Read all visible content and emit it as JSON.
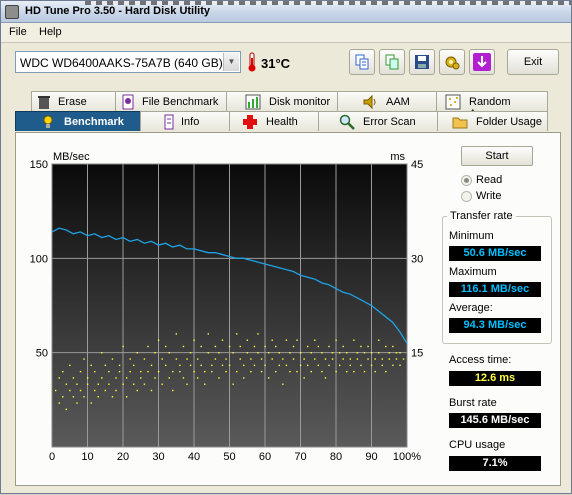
{
  "window": {
    "title": "HD Tune Pro 3.50 - Hard Disk Utility"
  },
  "menu": {
    "file": "File",
    "help": "Help"
  },
  "toolbar": {
    "drive": "WDC WD6400AAKS-75A7B (640 GB)",
    "temperature": "31°C",
    "exit_label": "Exit",
    "icons": [
      "copy-text-icon",
      "copy-screenshot-icon",
      "save-icon",
      "options-icon",
      "download-icon"
    ]
  },
  "tabs": {
    "row1": [
      "Erase",
      "File Benchmark",
      "Disk monitor",
      "AAM",
      "Random Access"
    ],
    "row2": [
      "Benchmark",
      "Info",
      "Health",
      "Error Scan",
      "Folder Usage"
    ],
    "active": "Benchmark"
  },
  "controls": {
    "start": "Start",
    "read": "Read",
    "write": "Write",
    "selected_mode": "Read"
  },
  "stats": {
    "transfer_rate_title": "Transfer rate",
    "minimum_label": "Minimum",
    "minimum": "50.6 MB/sec",
    "maximum_label": "Maximum",
    "maximum": "116.1 MB/sec",
    "average_label": "Average:",
    "average": "94.3 MB/sec",
    "access_label": "Access time:",
    "access": "12.6 ms",
    "burst_label": "Burst rate",
    "burst": "145.6 MB/sec",
    "cpu_label": "CPU usage",
    "cpu": "7.1%",
    "colors": {
      "transfer": "#00bfff",
      "access": "#ffff40",
      "plain": "#ffffff"
    }
  },
  "chart_data": {
    "type": "line",
    "y_left_label": "MB/sec",
    "y_right_label": "ms",
    "y_left_ticks": [
      "150",
      "100",
      "50"
    ],
    "y_right_ticks": [
      "45",
      "30",
      "15"
    ],
    "x_ticks": [
      "0",
      "10",
      "20",
      "30",
      "40",
      "50",
      "60",
      "70",
      "80",
      "90",
      "100%"
    ],
    "ylim_left": [
      0,
      150
    ],
    "ylim_right": [
      0,
      45
    ],
    "xlim": [
      0,
      100
    ],
    "series": [
      {
        "kind": "transfer_rate",
        "color": "#1fa3e6",
        "x": [
          0,
          2,
          4,
          6,
          8,
          10,
          12,
          14,
          16,
          18,
          20,
          22,
          24,
          26,
          28,
          30,
          32,
          34,
          36,
          38,
          40,
          42,
          44,
          46,
          48,
          50,
          52,
          54,
          56,
          58,
          60,
          62,
          64,
          66,
          68,
          70,
          72,
          74,
          76,
          78,
          80,
          82,
          84,
          86,
          88,
          90,
          92,
          94,
          96,
          98,
          100
        ],
        "y": [
          114,
          116,
          115,
          113,
          114,
          112,
          113,
          111,
          112,
          110,
          111,
          109,
          110,
          108,
          109,
          107,
          108,
          106,
          107,
          105,
          105,
          104,
          103,
          103,
          102,
          101,
          100,
          100,
          99,
          98,
          97,
          96,
          95,
          94,
          93,
          91,
          90,
          89,
          87,
          86,
          84,
          82,
          81,
          79,
          77,
          75,
          72,
          69,
          66,
          61,
          55
        ]
      }
    ],
    "access_time_points": {
      "color": "#ffff33",
      "x": [
        1,
        2,
        2,
        3,
        3,
        4,
        4,
        5,
        5,
        6,
        6,
        7,
        7,
        8,
        8,
        9,
        9,
        10,
        10,
        11,
        11,
        12,
        12,
        13,
        13,
        14,
        14,
        15,
        15,
        16,
        16,
        17,
        17,
        18,
        18,
        19,
        19,
        20,
        20,
        21,
        21,
        22,
        22,
        23,
        23,
        24,
        24,
        25,
        25,
        26,
        26,
        27,
        27,
        28,
        28,
        29,
        29,
        30,
        30,
        31,
        31,
        32,
        32,
        33,
        33,
        34,
        34,
        35,
        35,
        36,
        36,
        37,
        37,
        38,
        38,
        39,
        39,
        40,
        40,
        41,
        41,
        42,
        42,
        43,
        43,
        44,
        44,
        45,
        45,
        46,
        46,
        47,
        47,
        48,
        48,
        49,
        49,
        50,
        50,
        51,
        51,
        52,
        52,
        53,
        53,
        54,
        54,
        55,
        55,
        56,
        56,
        57,
        57,
        58,
        58,
        59,
        59,
        60,
        60,
        61,
        61,
        62,
        62,
        63,
        63,
        64,
        64,
        65,
        65,
        66,
        66,
        67,
        67,
        68,
        68,
        69,
        69,
        70,
        70,
        71,
        71,
        72,
        72,
        73,
        73,
        74,
        74,
        75,
        75,
        76,
        76,
        77,
        77,
        78,
        78,
        79,
        79,
        80,
        80,
        81,
        81,
        82,
        82,
        83,
        83,
        84,
        84,
        85,
        85,
        86,
        86,
        87,
        87,
        88,
        88,
        89,
        89,
        90,
        90,
        91,
        91,
        92,
        92,
        93,
        93,
        94,
        94,
        95,
        95,
        96,
        96,
        97,
        97,
        98,
        98,
        99
      ],
      "y": [
        9,
        11,
        7,
        8,
        12,
        10,
        6,
        13,
        9,
        8,
        11,
        10,
        7,
        12,
        9,
        14,
        8,
        10,
        11,
        7,
        13,
        9,
        12,
        10,
        8,
        11,
        15,
        9,
        13,
        10,
        12,
        8,
        14,
        11,
        9,
        13,
        12,
        10,
        16,
        11,
        8,
        14,
        12,
        10,
        13,
        15,
        9,
        12,
        11,
        14,
        10,
        16,
        12,
        13,
        9,
        15,
        11,
        17,
        12,
        14,
        10,
        13,
        16,
        11,
        15,
        12,
        9,
        14,
        18,
        12,
        13,
        11,
        16,
        10,
        14,
        13,
        15,
        12,
        17,
        11,
        14,
        13,
        16,
        12,
        10,
        15,
        18,
        13,
        12,
        14,
        16,
        11,
        15,
        13,
        17,
        12,
        14,
        16,
        13,
        10,
        15,
        18,
        12,
        14,
        16,
        13,
        11,
        15,
        17,
        14,
        12,
        16,
        13,
        15,
        18,
        12,
        14,
        16,
        13,
        11,
        15,
        17,
        14,
        12,
        16,
        13,
        15,
        10,
        14,
        17,
        13,
        12,
        15,
        16,
        14,
        12,
        17,
        13,
        15,
        11,
        14,
        16,
        13,
        15,
        12,
        17,
        14,
        13,
        16,
        12,
        15,
        14,
        11,
        16,
        13,
        15,
        14,
        12,
        17,
        13,
        15,
        14,
        16,
        12,
        15,
        13,
        14,
        17,
        12,
        15,
        14,
        13,
        16,
        15,
        12,
        14,
        16,
        13,
        15,
        14,
        12,
        17,
        15,
        13,
        14,
        16,
        12,
        15,
        14,
        13,
        16,
        15,
        14,
        13,
        15,
        14
      ]
    },
    "grid": true
  }
}
